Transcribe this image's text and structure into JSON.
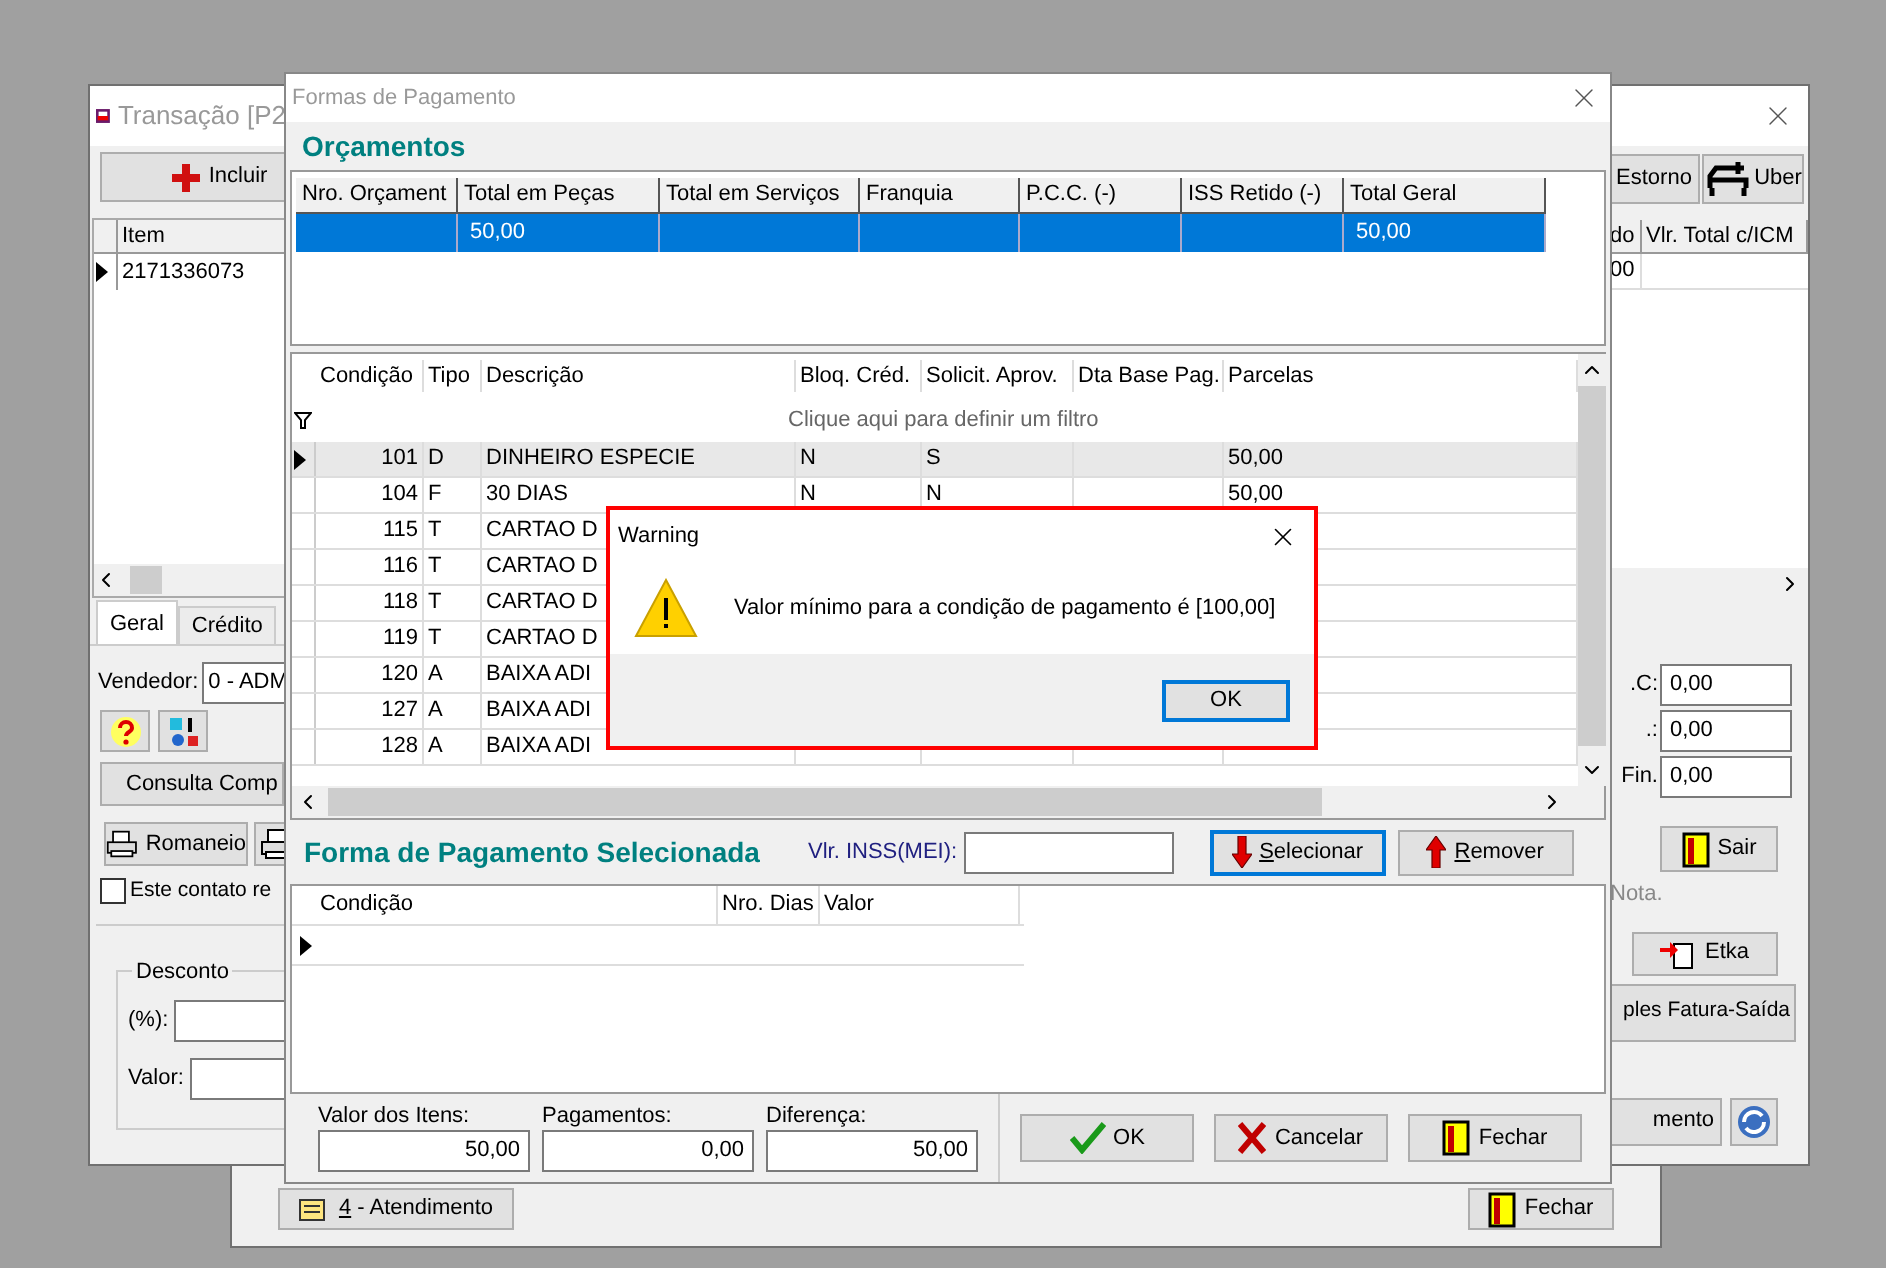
{
  "back_window": {
    "buttons": [
      {
        "kind": "service",
        "hotkey": "4",
        "label": " - Atendimento"
      },
      {
        "kind": "close",
        "label": "Fechar"
      }
    ]
  },
  "transaction_window": {
    "title": "Transação [P2",
    "left": {
      "add_button": "Incluir",
      "item_column": "Item",
      "item_rows": [
        {
          "item": "2171336073",
          "selected": true
        }
      ],
      "tabs": [
        {
          "label": "Geral",
          "selected": true
        },
        {
          "label": "Crédito",
          "selected": false
        }
      ],
      "seller_label": "Vendedor:",
      "seller_value": "0 - ADM",
      "query_button": "Consulta Comp",
      "print_button": "Romaneio",
      "contact_checkbox": {
        "label": "Este contato re",
        "checked": false
      },
      "discount": {
        "title": "Desconto",
        "fields": [
          {
            "label": "(%):"
          },
          {
            "label": "Valor:"
          }
        ]
      }
    },
    "right": {
      "reversal_button": "Estorno",
      "uber_button": "Uber",
      "columns": [
        "do",
        "Vlr. Total c/ICM"
      ],
      "row_value": "00",
      "totals": [
        {
          "label": ".C:",
          "value": "0,00"
        },
        {
          "label": ".:",
          "value": "0,00"
        },
        {
          "label": "Fin.",
          "value": "0,00"
        }
      ],
      "exit_button": "Sair",
      "note": "Nota.",
      "etka_button": "Etka",
      "invoice_button": "ples Fatura-Saída",
      "service_button": "mento"
    }
  },
  "payment_dialog": {
    "title": "Formas de Pagamento",
    "budgets": {
      "heading": "Orçamentos",
      "columns": [
        "Nro. Orçament",
        "Total em Peças",
        "Total em Serviços",
        "Franquia",
        "P.C.C. (-)",
        "ISS Retido (-)",
        "Total Geral"
      ],
      "rows": [
        {
          "selected": true,
          "total_pecas": "50,00",
          "total_geral": "50,00"
        }
      ]
    },
    "conditions": {
      "columns": [
        "Condição",
        "Tipo",
        "Descrição",
        "Bloq. Créd.",
        "Solicit. Aprov.",
        "Dta Base Pag.",
        "Parcelas"
      ],
      "filter_hint": "Clique aqui para definir um filtro",
      "rows": [
        {
          "selected": true,
          "condicao": "101",
          "tipo": "D",
          "descricao": "DINHEIRO ESPECIE",
          "bloq": "N",
          "solicit": "S",
          "parcelas": "50,00"
        },
        {
          "selected": false,
          "condicao": "104",
          "tipo": "F",
          "descricao": "30 DIAS",
          "bloq": "N",
          "solicit": "N",
          "parcelas": "50,00"
        },
        {
          "selected": false,
          "condicao": "115",
          "tipo": "T",
          "descricao": "CARTAO D"
        },
        {
          "selected": false,
          "condicao": "116",
          "tipo": "T",
          "descricao": "CARTAO D"
        },
        {
          "selected": false,
          "condicao": "118",
          "tipo": "T",
          "descricao": "CARTAO D"
        },
        {
          "selected": false,
          "condicao": "119",
          "tipo": "T",
          "descricao": "CARTAO D"
        },
        {
          "selected": false,
          "condicao": "120",
          "tipo": "A",
          "descricao": "BAIXA ADI"
        },
        {
          "selected": false,
          "condicao": "127",
          "tipo": "A",
          "descricao": "BAIXA ADI"
        },
        {
          "selected": false,
          "condicao": "128",
          "tipo": "A",
          "descricao": "BAIXA ADI"
        }
      ]
    },
    "selected_section": {
      "heading": "Forma de Pagamento Selecionada",
      "inss_label": "Vlr. INSS(MEI):",
      "buttons": [
        {
          "kind": "select",
          "hotkey": "S",
          "label": "elecionar",
          "focused": true
        },
        {
          "kind": "remove",
          "hotkey": "R",
          "label": "emover",
          "focused": false
        }
      ],
      "columns": [
        "Condição",
        "Nro. Dias",
        "Valor"
      ]
    },
    "summary": [
      {
        "label": "Valor dos Itens:",
        "value": "50,00"
      },
      {
        "label": "Pagamentos:",
        "value": "0,00"
      },
      {
        "label": "Diferença:",
        "value": "50,00"
      }
    ],
    "actions": [
      {
        "kind": "ok",
        "label": "OK"
      },
      {
        "kind": "cancel",
        "label": "Cancelar"
      },
      {
        "kind": "close",
        "label": "Fechar"
      }
    ]
  },
  "warning": {
    "title": "Warning",
    "message": "Valor mínimo para a condição de pagamento é [100,00]",
    "button": "OK"
  }
}
